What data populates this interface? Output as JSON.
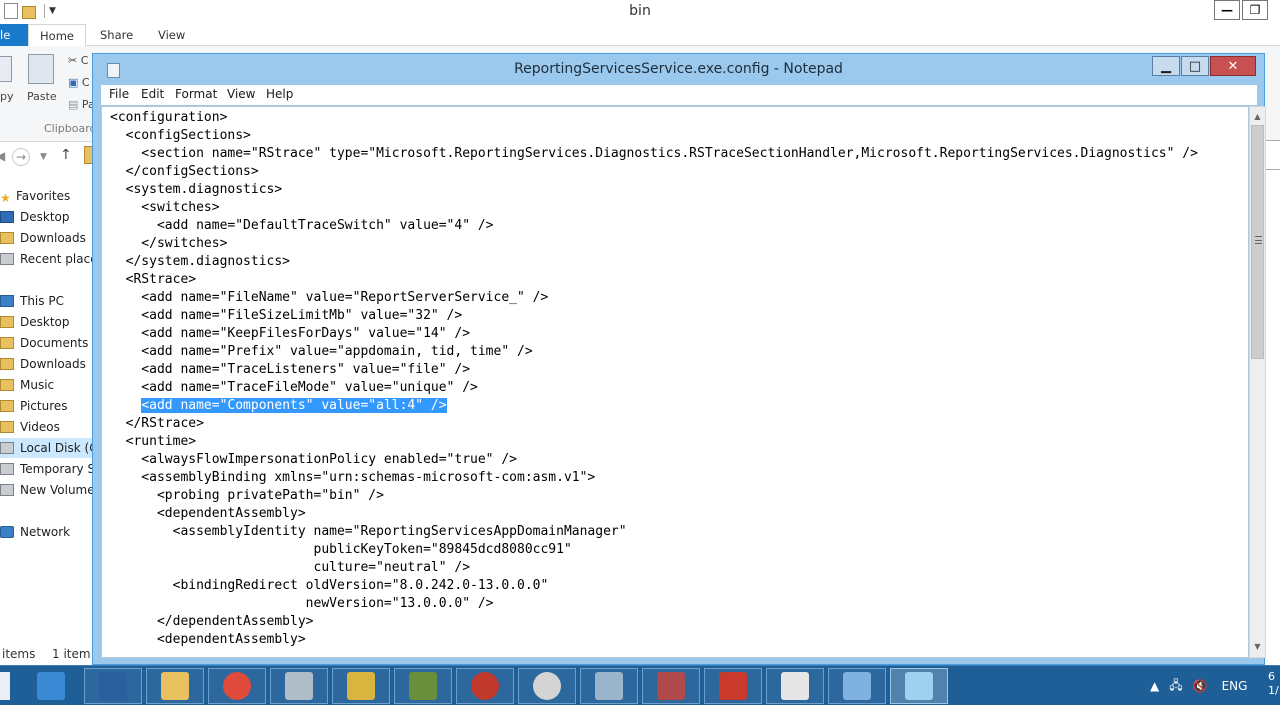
{
  "explorer": {
    "title": "bin",
    "tabs": {
      "file": "le",
      "home": "Home",
      "share": "Share",
      "view": "View"
    },
    "ribbon": {
      "copy": "py",
      "paste": "Paste",
      "cut_fragment": "C",
      "copy_path_fragment": "C",
      "paste_shortcut_fragment": "Pa",
      "clipboard": "Clipboard"
    },
    "nav": {
      "favorites": "Favorites",
      "desktop": "Desktop",
      "downloads": "Downloads",
      "recent": "Recent places",
      "thispc": "This PC",
      "pc_desktop": "Desktop",
      "documents": "Documents",
      "pc_downloads": "Downloads",
      "music": "Music",
      "pictures": "Pictures",
      "videos": "Videos",
      "localdisk": "Local Disk (C:",
      "temporary": "Temporary St",
      "newvolume": "New Volume",
      "network": "Network"
    },
    "status": {
      "items": "items",
      "selected": "1 item s"
    }
  },
  "notepad": {
    "title": "ReportingServicesService.exe.config - Notepad",
    "menu": {
      "file": "File",
      "edit": "Edit",
      "format": "Format",
      "view": "View",
      "help": "Help"
    },
    "content_before": "<configuration>\n  <configSections>\n    <section name=\"RStrace\" type=\"Microsoft.ReportingServices.Diagnostics.RSTraceSectionHandler,Microsoft.ReportingServices.Diagnostics\" />\n  </configSections>\n  <system.diagnostics>\n    <switches>\n      <add name=\"DefaultTraceSwitch\" value=\"4\" />\n    </switches>\n  </system.diagnostics>\n  <RStrace>\n    <add name=\"FileName\" value=\"ReportServerService_\" />\n    <add name=\"FileSizeLimitMb\" value=\"32\" />\n    <add name=\"KeepFilesForDays\" value=\"14\" />\n    <add name=\"Prefix\" value=\"appdomain, tid, time\" />\n    <add name=\"TraceListeners\" value=\"file\" />\n    <add name=\"TraceFileMode\" value=\"unique\" />\n    ",
    "content_selected": "<add name=\"Components\" value=\"all:4\" />",
    "content_after": "\n  </RStrace>\n  <runtime>\n    <alwaysFlowImpersonationPolicy enabled=\"true\" />\n    <assemblyBinding xmlns=\"urn:schemas-microsoft-com:asm.v1\">\n      <probing privatePath=\"bin\" />\n      <dependentAssembly>\n        <assemblyIdentity name=\"ReportingServicesAppDomainManager\"\n                          publicKeyToken=\"89845dcd8080cc91\"\n                          culture=\"neutral\" />\n        <bindingRedirect oldVersion=\"8.0.242.0-13.0.0.0\"\n                         newVersion=\"13.0.0.0\" />\n      </dependentAssembly>\n      <dependentAssembly>"
  },
  "taskbar": {
    "lang": "ENG",
    "clock_line1": "6",
    "clock_line2": "1/",
    "apps": [
      {
        "icon": "server-manager-icon",
        "color": "#3a8ad6"
      },
      {
        "icon": "powershell-icon",
        "color": "#2b5f9e"
      },
      {
        "icon": "file-explorer-icon",
        "color": "#e8c060"
      },
      {
        "icon": "chrome-icon",
        "color": "#e04a3a"
      },
      {
        "icon": "services-gear-icon",
        "color": "#b0bcc8"
      },
      {
        "icon": "component-services-icon",
        "color": "#d9b540"
      },
      {
        "icon": "sql-config-icon",
        "color": "#6a8f3a"
      },
      {
        "icon": "compass-icon",
        "color": "#c0392b"
      },
      {
        "icon": "clock-icon",
        "color": "#d4d4d4"
      },
      {
        "icon": "performance-monitor-icon",
        "color": "#9ab4cc"
      },
      {
        "icon": "reporting-config-icon",
        "color": "#b04a4a"
      },
      {
        "icon": "toolbox-icon",
        "color": "#c93a2c"
      },
      {
        "icon": "report-builder-icon",
        "color": "#e6e6e6"
      },
      {
        "icon": "network-admin-icon",
        "color": "#7fb2e0"
      },
      {
        "icon": "notepad-icon",
        "color": "#9fd0ef"
      }
    ]
  }
}
